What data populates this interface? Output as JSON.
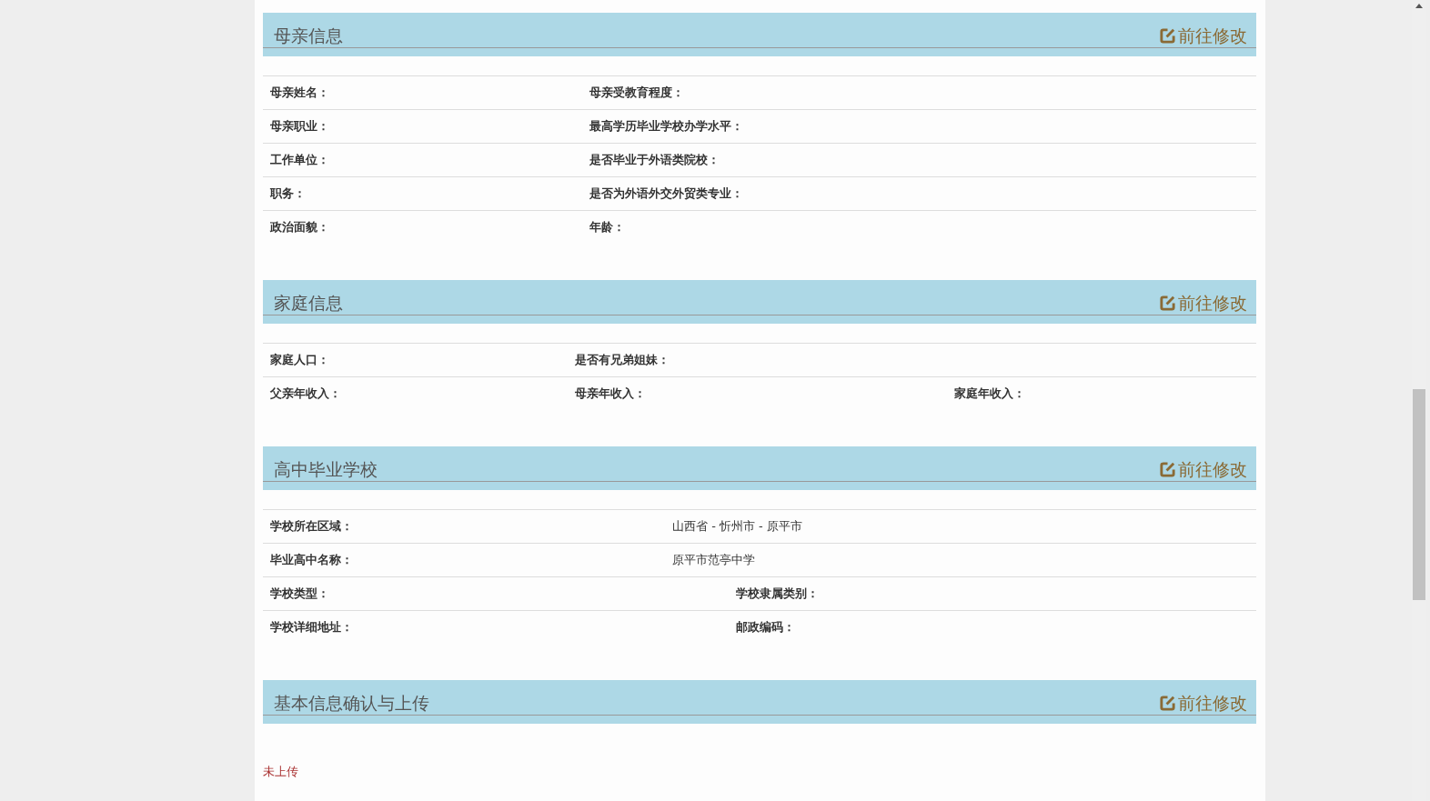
{
  "sections": [
    {
      "title": "母亲信息",
      "edit_link": "前往修改",
      "rows": [
        {
          "cells": [
            {
              "kind": "label",
              "text": "母亲姓名："
            },
            {
              "kind": "label",
              "text": "母亲受教育程度："
            }
          ]
        },
        {
          "cells": [
            {
              "kind": "label",
              "text": "母亲职业："
            },
            {
              "kind": "label",
              "text": "最高学历毕业学校办学水平："
            }
          ]
        },
        {
          "cells": [
            {
              "kind": "label",
              "text": "工作单位："
            },
            {
              "kind": "label",
              "text": "是否毕业于外语类院校："
            }
          ]
        },
        {
          "cells": [
            {
              "kind": "label",
              "text": "职务："
            },
            {
              "kind": "label",
              "text": "是否为外语外交外贸类专业："
            }
          ]
        },
        {
          "cells": [
            {
              "kind": "label",
              "text": "政治面貌："
            },
            {
              "kind": "label",
              "text": "年龄："
            }
          ]
        }
      ]
    },
    {
      "title": "家庭信息",
      "edit_link": "前往修改",
      "rows": [
        {
          "cells": [
            {
              "kind": "label",
              "text": "家庭人口："
            },
            {
              "kind": "label",
              "text": "是否有兄弟姐妹："
            }
          ]
        },
        {
          "cells": [
            {
              "kind": "label",
              "text": "父亲年收入："
            },
            {
              "kind": "label",
              "text": "母亲年收入："
            },
            {
              "kind": "label",
              "text": "家庭年收入："
            }
          ]
        }
      ]
    },
    {
      "title": "高中毕业学校",
      "edit_link": "前往修改",
      "rows": [
        {
          "cells": [
            {
              "kind": "label",
              "text": "学校所在区域："
            },
            {
              "kind": "value",
              "text": "山西省 - 忻州市 - 原平市"
            }
          ]
        },
        {
          "cells": [
            {
              "kind": "label",
              "text": "毕业高中名称："
            },
            {
              "kind": "value",
              "text": "原平市范亭中学"
            }
          ]
        },
        {
          "cells": [
            {
              "kind": "label",
              "text": "学校类型："
            },
            {
              "kind": "label",
              "text": "学校隶属类别："
            }
          ]
        },
        {
          "cells": [
            {
              "kind": "label",
              "text": "学校详细地址："
            },
            {
              "kind": "label",
              "text": "邮政编码："
            }
          ]
        }
      ]
    },
    {
      "title": "基本信息确认与上传",
      "edit_link": "前往修改",
      "status": "未上传"
    }
  ]
}
